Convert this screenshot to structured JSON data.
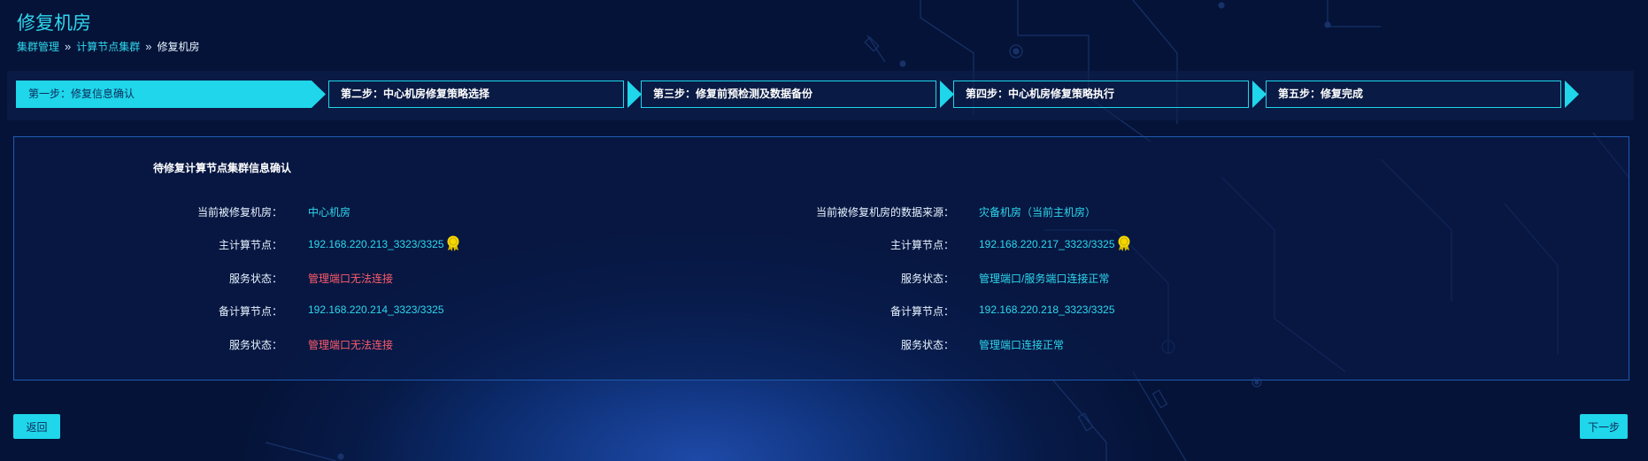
{
  "page": {
    "title": "修复机房",
    "breadcrumb": [
      {
        "label": "集群管理",
        "link": true
      },
      {
        "label": "计算节点集群",
        "link": true
      },
      {
        "label": "修复机房",
        "link": false
      }
    ],
    "breadcrumb_sep": "»"
  },
  "steps": [
    {
      "label": "第一步：修复信息确认",
      "active": true
    },
    {
      "label": "第二步：中心机房修复策略选择",
      "active": false
    },
    {
      "label": "第三步：修复前预检测及数据备份",
      "active": false
    },
    {
      "label": "第四步：中心机房修复策略执行",
      "active": false
    },
    {
      "label": "第五步：修复完成",
      "active": false
    }
  ],
  "panel": {
    "title": "待修复计算节点集群信息确认",
    "left": {
      "current_room_label": "当前被修复机房：",
      "current_room_value": "中心机房",
      "master_label": "主计算节点：",
      "master_value": "192.168.220.213_3323/3325",
      "master_status_label": "服务状态：",
      "master_status_value": "管理端口无法连接",
      "backup_label": "备计算节点：",
      "backup_value": "192.168.220.214_3323/3325",
      "backup_status_label": "服务状态：",
      "backup_status_value": "管理端口无法连接"
    },
    "right": {
      "source_label": "当前被修复机房的数据来源：",
      "source_value": "灾备机房（当前主机房）",
      "master_label": "主计算节点：",
      "master_value": "192.168.220.217_3323/3325",
      "master_status_label": "服务状态：",
      "master_status_value": "管理端口/服务端口连接正常",
      "backup_label": "备计算节点：",
      "backup_value": "192.168.220.218_3323/3325",
      "backup_status_label": "服务状态：",
      "backup_status_value": "管理端口连接正常"
    }
  },
  "buttons": {
    "back": "返回",
    "next": "下一步"
  },
  "colors": {
    "accent": "#1fd6ea",
    "error": "#ff5c6c",
    "border": "#1f5ab0",
    "badge": "#f5d800"
  },
  "icons": {
    "master_badge": "medal-icon"
  }
}
